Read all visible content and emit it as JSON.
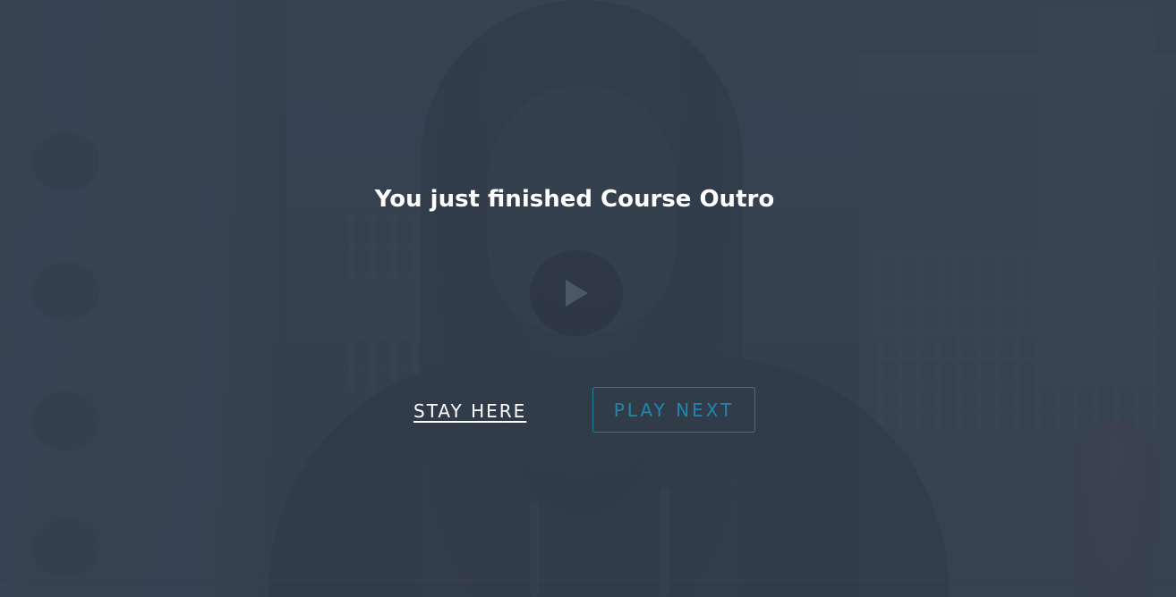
{
  "end_screen": {
    "title": "You just finished Course Outro",
    "stay_label": "STAY HERE",
    "play_next_label": "PLAY NEXT"
  },
  "video_player": {
    "play_icon": "play-icon",
    "state": "ended"
  },
  "colors": {
    "overlay": "#34404e",
    "title_text": "#ffffff",
    "accent": "#1f86ad"
  }
}
